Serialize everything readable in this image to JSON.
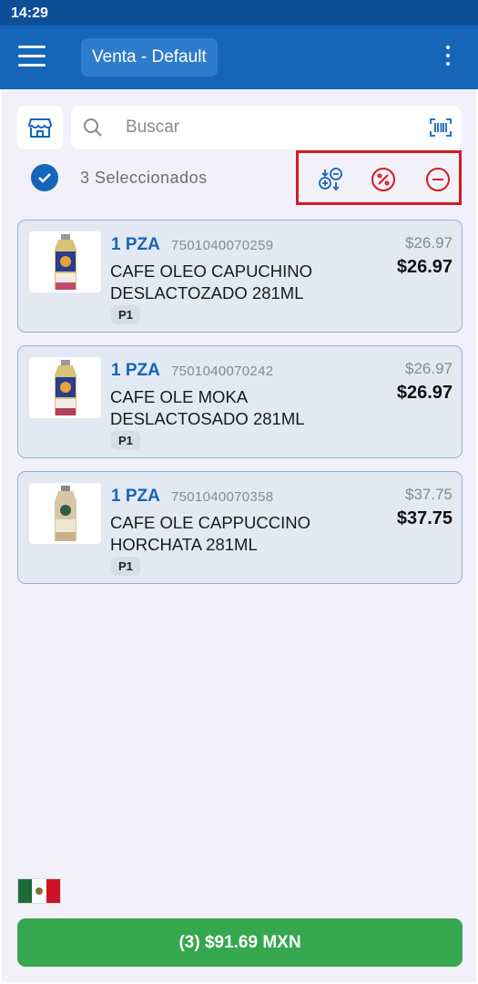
{
  "status_bar": {
    "time": "14:29"
  },
  "app_bar": {
    "title": "Venta - Default"
  },
  "search": {
    "placeholder": "Buscar"
  },
  "selection": {
    "text": "3 Seleccionados"
  },
  "items": [
    {
      "qty": "1 PZA",
      "code": "7501040070259",
      "name_line1": "CAFE OLEO CAPUCHINO",
      "name_line2": "DESLACTOZADO 281ML",
      "badge": "P1",
      "price_original": "$26.97",
      "price": "$26.97"
    },
    {
      "qty": "1 PZA",
      "code": "7501040070242",
      "name_line1": "CAFE OLE MOKA",
      "name_line2": "DESLACTOSADO 281ML",
      "badge": "P1",
      "price_original": "$26.97",
      "price": "$26.97"
    },
    {
      "qty": "1 PZA",
      "code": "7501040070358",
      "name_line1": "CAFE OLE CAPPUCCINO",
      "name_line2": "HORCHATA 281ML",
      "badge": "P1",
      "price_original": "$37.75",
      "price": "$37.75"
    }
  ],
  "checkout": {
    "label": "(3) $91.69 MXN"
  },
  "colors": {
    "primary": "#1565b8",
    "accent_red": "#d51a22",
    "checkout_green": "#35a74f"
  },
  "icons": [
    "menu-icon",
    "more-vert-icon",
    "store-icon",
    "search-icon",
    "barcode-scan-icon",
    "check-icon",
    "quantity-adjust-icon",
    "discount-icon",
    "remove-icon",
    "mexico-flag-icon"
  ]
}
